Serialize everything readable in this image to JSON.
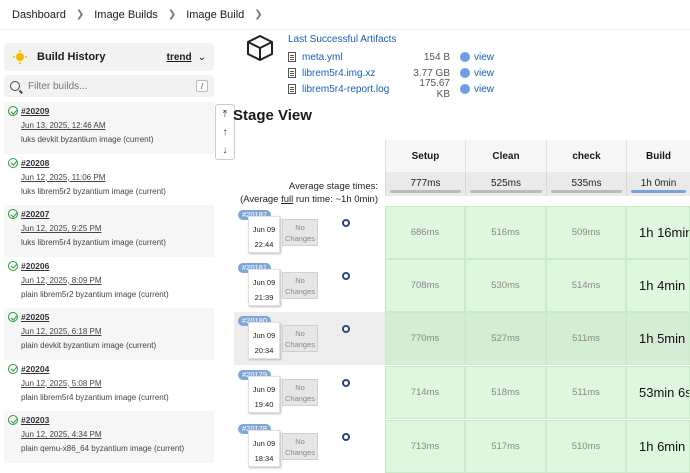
{
  "breadcrumb": [
    "Dashboard",
    "Image Builds",
    "Image Build"
  ],
  "sidebar": {
    "title": "Build History",
    "trend_label": "trend",
    "filter_placeholder": "Filter builds...",
    "filter_shortcut": "/",
    "builds": [
      {
        "number": "#20209",
        "date": "Jun 13, 2025, 12:46 AM",
        "desc": "luks devkit byzantium image (current)"
      },
      {
        "number": "#20208",
        "date": "Jun 12, 2025, 11:06 PM",
        "desc": "luks librem5r2 byzantium image (current)"
      },
      {
        "number": "#20207",
        "date": "Jun 12, 2025, 9:25 PM",
        "desc": "luks librem5r4 byzantium image (current)"
      },
      {
        "number": "#20206",
        "date": "Jun 12, 2025, 8:09 PM",
        "desc": "plain librem5r2 byzantium image (current)"
      },
      {
        "number": "#20205",
        "date": "Jun 12, 2025, 6:18 PM",
        "desc": "plain devkit byzantium image (current)"
      },
      {
        "number": "#20204",
        "date": "Jun 12, 2025, 5:08 PM",
        "desc": "plain librem5r4 byzantium image (current)"
      },
      {
        "number": "#20203",
        "date": "Jun 12, 2025, 4:34 PM",
        "desc": "plain qemu-x86_64 byzantium image (current)"
      }
    ]
  },
  "artifacts": {
    "title": "Last Successful Artifacts",
    "files": [
      {
        "name": "meta.yml",
        "size": "154 B",
        "view": "view"
      },
      {
        "name": "librem5r4.img.xz",
        "size": "3.77 GB",
        "view": "view"
      },
      {
        "name": "librem5r4-report.log",
        "size": "175.67 KB",
        "view": "view"
      }
    ]
  },
  "stage_view": {
    "title": "Stage View",
    "avg_label_1": "Average stage times:",
    "avg_label_2a": "(Average ",
    "avg_label_2b": "full",
    "avg_label_2c": " run time: ~1h 0min)",
    "stages": [
      {
        "name": "Setup",
        "avg": "777ms"
      },
      {
        "name": "Clean",
        "avg": "525ms"
      },
      {
        "name": "check",
        "avg": "535ms"
      },
      {
        "name": "Build",
        "avg": "1h 0min"
      }
    ],
    "no_changes_label": "No Changes",
    "runs": [
      {
        "number": "#20182",
        "day": "Jun 09",
        "time": "22:44",
        "times": [
          "686ms",
          "516ms",
          "509ms",
          "1h 16min"
        ]
      },
      {
        "number": "#20181",
        "day": "Jun 09",
        "time": "21:39",
        "times": [
          "708ms",
          "530ms",
          "514ms",
          "1h 4min"
        ]
      },
      {
        "number": "#20180",
        "day": "Jun 09",
        "time": "20:34",
        "times": [
          "770ms",
          "527ms",
          "511ms",
          "1h 5min"
        ]
      },
      {
        "number": "#20179",
        "day": "Jun 09",
        "time": "19:40",
        "times": [
          "714ms",
          "518ms",
          "511ms",
          "53min 6s"
        ]
      },
      {
        "number": "#20178",
        "day": "Jun 09",
        "time": "18:34",
        "times": [
          "713ms",
          "517ms",
          "510ms",
          "1h 6min"
        ]
      }
    ]
  }
}
